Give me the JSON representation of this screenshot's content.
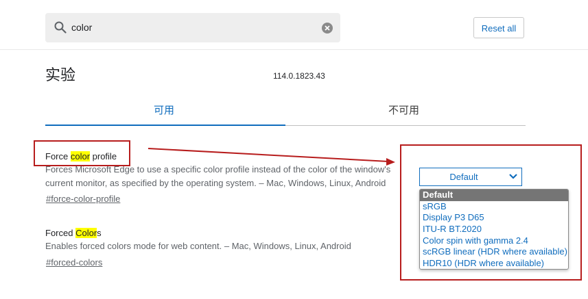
{
  "search": {
    "value": "color"
  },
  "header": {
    "reset_label": "Reset all"
  },
  "page": {
    "title": "实验",
    "version": "114.0.1823.43"
  },
  "tabs": [
    {
      "label": "可用",
      "active": true
    },
    {
      "label": "不可用",
      "active": false
    }
  ],
  "experiments": [
    {
      "title_pre": "Force ",
      "title_hl": "color",
      "title_post": " profile",
      "desc_line1": "Forces Microsoft Edge to use a specific color profile instead of the color of the window's",
      "desc_line2": "current monitor, as specified by the operating system. – Mac, Windows, Linux, Android",
      "link": "#force-color-profile",
      "selected": "Default"
    },
    {
      "title_pre": "Forced ",
      "title_hl": "Color",
      "title_post": "s",
      "desc_line1": "Enables forced colors mode for web content. – Mac, Windows, Linux, Android",
      "link": "#forced-colors"
    }
  ],
  "dropdown": {
    "options": [
      "Default",
      "sRGB",
      "Display P3 D65",
      "ITU-R BT.2020",
      "Color spin with gamma 2.4",
      "scRGB linear (HDR where available)",
      "HDR10 (HDR where available)"
    ],
    "selected_index": 0
  },
  "colors": {
    "accent": "#0f6cbd",
    "annotation": "#b71c1c",
    "highlight": "#ffff00"
  }
}
